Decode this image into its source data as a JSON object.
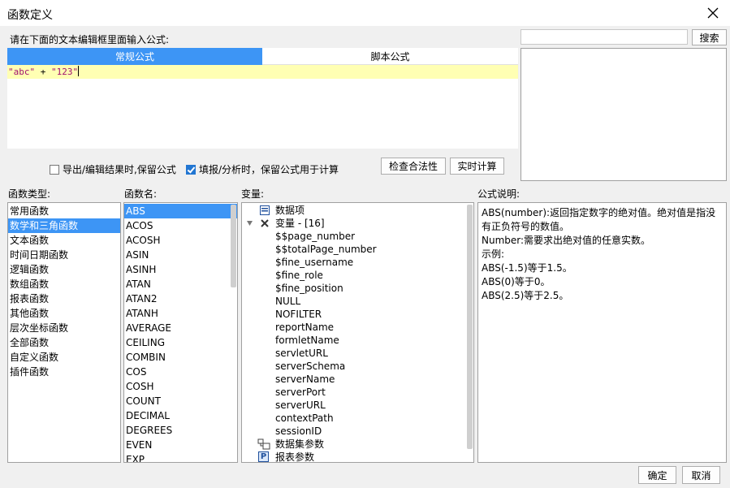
{
  "window": {
    "title": "函数定义"
  },
  "editor": {
    "prompt": "请在下面的文本编辑框里面输入公式:",
    "tabs": [
      {
        "label": "常规公式",
        "active": true
      },
      {
        "label": "脚本公式",
        "active": false
      }
    ],
    "formula": {
      "part1": "\"abc\"",
      "op": " + ",
      "part2": "\"123\""
    }
  },
  "options": {
    "export_keep": {
      "label": "导出/编辑结果时,保留公式",
      "checked": false
    },
    "fill_keep": {
      "label": "填报/分析时，保留公式用于计算",
      "checked": true
    }
  },
  "buttons": {
    "check": "检查合法性",
    "realtime": "实时计算",
    "search": "搜索",
    "ok": "确定",
    "cancel": "取消"
  },
  "search": {
    "value": ""
  },
  "function_types": {
    "label": "函数类型:",
    "items": [
      "常用函数",
      "数学和三角函数",
      "文本函数",
      "时间日期函数",
      "逻辑函数",
      "数组函数",
      "报表函数",
      "其他函数",
      "层次坐标函数",
      "全部函数",
      "自定义函数",
      "插件函数"
    ],
    "selected": 1
  },
  "function_names": {
    "label": "函数名:",
    "items": [
      "ABS",
      "ACOS",
      "ACOSH",
      "ASIN",
      "ASINH",
      "ATAN",
      "ATAN2",
      "ATANH",
      "AVERAGE",
      "CEILING",
      "COMBIN",
      "COS",
      "COSH",
      "COUNT",
      "DECIMAL",
      "DEGREES",
      "EVEN",
      "EXP"
    ],
    "selected": 0
  },
  "variables": {
    "label": "变量:",
    "data_item": "数据项",
    "var_group": "变量 - [16]",
    "items": [
      "$$page_number",
      "$$totalPage_number",
      "$fine_username",
      "$fine_role",
      "$fine_position",
      "NULL",
      "NOFILTER",
      "reportName",
      "formletName",
      "servletURL",
      "serverSchema",
      "serverName",
      "serverPort",
      "serverURL",
      "contextPath",
      "sessionID"
    ],
    "dataset_params": "数据集参数",
    "report_params": "报表参数",
    "report_params_icon_letter": "P"
  },
  "description": {
    "label": "公式说明:",
    "lines": [
      "ABS(number):返回指定数字的绝对值。绝对值是指没有正负符号的数值。",
      "Number:需要求出绝对值的任意实数。",
      "示例:",
      "ABS(-1.5)等于1.5。",
      "ABS(0)等于0。",
      "ABS(2.5)等于2.5。"
    ]
  },
  "colors": {
    "accent": "#3d95f5",
    "formula_bg": "#ffffb3",
    "string": "#a1116f"
  }
}
